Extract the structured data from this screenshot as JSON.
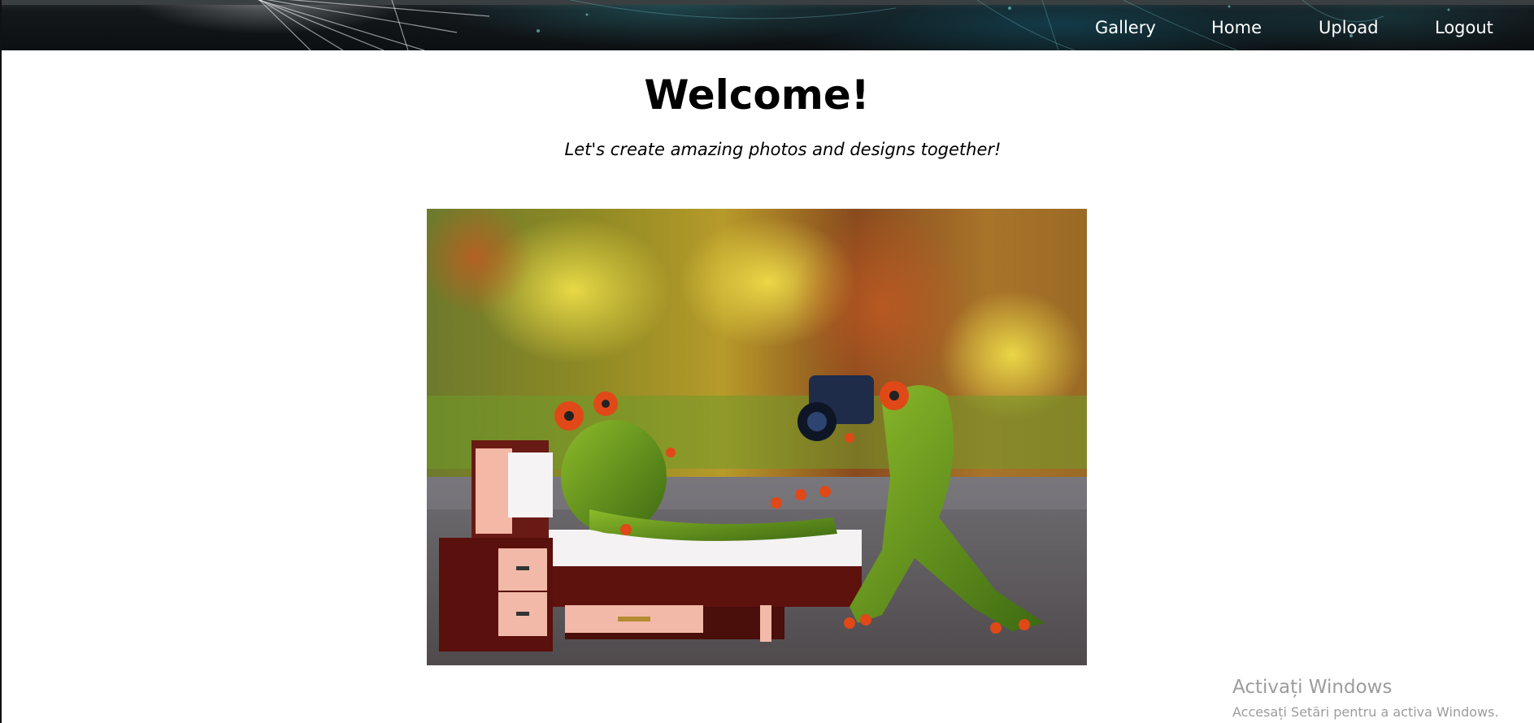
{
  "navbar": {
    "links": [
      {
        "label": "Gallery"
      },
      {
        "label": "Home"
      },
      {
        "label": "Upload"
      },
      {
        "label": "Logout"
      }
    ]
  },
  "main": {
    "title": "Welcome!",
    "subtitle": "Let's create amazing photos and designs together!"
  },
  "photo": {
    "icon": "hero-photo-frogs"
  },
  "watermark": {
    "title": "Activați Windows",
    "subtitle": "Accesați Setări pentru a activa Windows."
  },
  "colors": {
    "navbar": "#0d1012",
    "text": "#000000",
    "nav_text": "#ffffff",
    "watermark": "#9c9c9c"
  }
}
